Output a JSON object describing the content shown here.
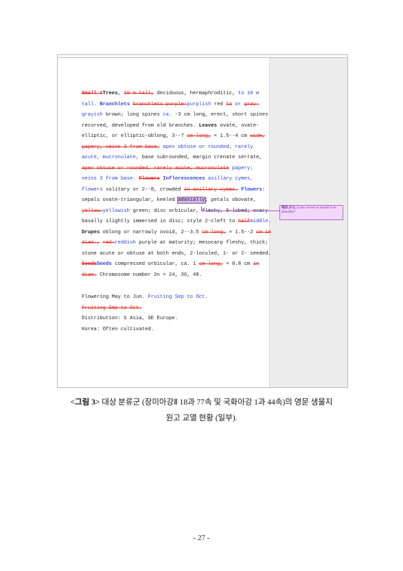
{
  "document": {
    "lines": [
      [
        {
          "t": "Small t",
          "s": "del b"
        },
        {
          "t": "Trees",
          "s": "b"
        },
        {
          "t": ", "
        },
        {
          "t": "10 m tall,",
          "s": "del"
        },
        {
          "t": " deciduous, hermaphroditic, "
        },
        {
          "t": "to 10 m",
          "s": "ins"
        }
      ],
      [
        {
          "t": "tall. ",
          "s": "ins"
        },
        {
          "t": " "
        },
        {
          "t": "Branchlets",
          "s": "ins b"
        },
        {
          "t": " "
        },
        {
          "t": "branchlets purple-",
          "s": "del"
        },
        {
          "t": "purplish",
          "s": "ins"
        },
        {
          "t": " red "
        },
        {
          "t": "to",
          "s": "del"
        },
        {
          "t": " "
        },
        {
          "t": "or",
          "s": "ins"
        },
        {
          "t": " "
        },
        {
          "t": "gray-",
          "s": "del"
        }
      ],
      [
        {
          "t": "grayish",
          "s": "ins"
        },
        {
          "t": " brown; long spines "
        },
        {
          "t": "ca. ",
          "s": "ins"
        },
        {
          "t": "-3 cm long, erect, short spines"
        }
      ],
      [
        {
          "t": "recurved, developed from old branches. "
        },
        {
          "t": "Leaves",
          "s": "b"
        },
        {
          "t": " ovate, ovate-"
        }
      ],
      [
        {
          "t": "elliptic, or elliptic-oblong, 3--7 "
        },
        {
          "t": "cm long,",
          "s": "del"
        },
        {
          "t": " × 1.5--4 cm "
        },
        {
          "t": "wide,",
          "s": "del"
        }
      ],
      [
        {
          "t": "papery, veins 3 from base,",
          "s": "del"
        },
        {
          "t": " apex obtuse or rounded, rarely",
          "s": "ins"
        }
      ],
      [
        {
          "t": "acute, mucronulate,",
          "s": "ins"
        },
        {
          "t": " base subrounded, margin crenate serrate,"
        }
      ],
      [
        {
          "t": "apex obtuse or rounded, rarely acute, mucronulate",
          "s": "del"
        },
        {
          "t": " papery;",
          "s": "ins"
        }
      ],
      [
        {
          "t": "veins 3 from base. ",
          "s": "ins"
        },
        {
          "t": " "
        },
        {
          "t": "Flowers",
          "s": "del b"
        },
        {
          "t": " "
        },
        {
          "t": "Inflorescences",
          "s": "ins b"
        },
        {
          "t": " axillary cymes,",
          "s": "ins"
        }
      ],
      [
        {
          "t": "flowers",
          "s": "ins"
        },
        {
          "t": " solitary or 2--8, crowded "
        },
        {
          "t": "in axillary cymes.",
          "s": "del"
        },
        {
          "t": " "
        },
        {
          "t": "Flowers:",
          "s": "ins b"
        }
      ],
      [
        {
          "t": "sepals ovate-triangular, keeled "
        },
        {
          "t": "adaxially",
          "s": "hl"
        },
        {
          "t": "; petals obovate,"
        }
      ],
      [
        {
          "t": "yellow-",
          "s": "del"
        },
        {
          "t": "yellowish",
          "s": "ins"
        },
        {
          "t": " green; disc orbicular, fleshy, 5-lobed; ovary"
        }
      ],
      [
        {
          "t": "basally slightly immersed in disc; style 2-cleft to "
        },
        {
          "t": "half",
          "s": "del"
        },
        {
          "t": "middle.",
          "s": "ins"
        }
      ],
      [
        {
          "t": "Drupes",
          "s": "b"
        },
        {
          "t": " oblong or narrowly ovoid, 2--3.5 "
        },
        {
          "t": "cm long,",
          "s": "del"
        },
        {
          "t": " × 1.5--2 "
        },
        {
          "t": "cm in",
          "s": "del"
        }
      ],
      [
        {
          "t": "diam.,",
          "s": "del"
        },
        {
          "t": " "
        },
        {
          "t": "red-",
          "s": "del"
        },
        {
          "t": "reddish",
          "s": "ins"
        },
        {
          "t": " purple at maturity; mesocarp fleshy, thick;"
        }
      ],
      [
        {
          "t": "stone acute or obtuse at both ends, 2-loculed, 1- or 2- seeded."
        }
      ],
      [
        {
          "t": "Seeds",
          "s": "del b"
        },
        {
          "t": "Seeds",
          "s": "ins b"
        },
        {
          "t": " compressed orbicular, ca. 1 "
        },
        {
          "t": "cm long,",
          "s": "del"
        },
        {
          "t": " × 0.8 cm "
        },
        {
          "t": "in",
          "s": "del"
        }
      ],
      [
        {
          "t": "diam.",
          "s": "del"
        },
        {
          "t": "  Chromosome number 2n = 24, 36, 48."
        }
      ],
      [],
      [
        {
          "t": "   Flowering May to Jun. "
        },
        {
          "t": "Fruiting Sep to Oct.",
          "s": "ins"
        }
      ],
      [
        {
          "t": "   Fruiting Sep to Oct.",
          "s": "del"
        }
      ],
      [
        {
          "t": "   Distribution:  S Asia, SE Europe."
        }
      ],
      [
        {
          "t": "   Korea:  Often cultivated."
        }
      ]
    ]
  },
  "comment": {
    "label": "메모 [F1]:",
    "text": " Is this correct or should it be abaxially?"
  },
  "caption": {
    "label": "<그림 3>",
    "line1": " 대상 분류군 (장미아강Ⅱ 18과 77속 및 국화아강 1과 44속)의 영문 생물지",
    "line2": "원고 교열 현황 (일부)."
  },
  "page_number": "- 27 -"
}
